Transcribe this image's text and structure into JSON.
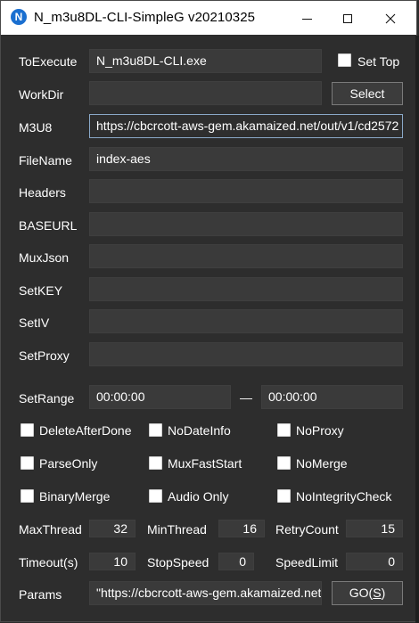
{
  "window": {
    "title": "N_m3u8DL-CLI-SimpleG v20210325",
    "icon_letter": "N"
  },
  "form": {
    "toexecute": {
      "label": "ToExecute",
      "value": "N_m3u8DL-CLI.exe"
    },
    "set_top": {
      "label": "Set Top",
      "checked": false
    },
    "workdir": {
      "label": "WorkDir",
      "value": ""
    },
    "select_button": "Select",
    "m3u8": {
      "label": "M3U8",
      "value": "https://cbcrcott-aws-gem.akamaized.net/out/v1/cd2572"
    },
    "filename": {
      "label": "FileName",
      "value": "index-aes"
    },
    "headers": {
      "label": "Headers",
      "value": ""
    },
    "baseurl": {
      "label": "BASEURL",
      "value": ""
    },
    "muxjson": {
      "label": "MuxJson",
      "value": ""
    },
    "setkey": {
      "label": "SetKEY",
      "value": ""
    },
    "setiv": {
      "label": "SetIV",
      "value": ""
    },
    "setproxy": {
      "label": "SetProxy",
      "value": ""
    },
    "setrange": {
      "label": "SetRange",
      "start": "00:00:00",
      "separator": "—",
      "end": "00:00:00"
    }
  },
  "options": [
    {
      "label": "DeleteAfterDone",
      "checked": false
    },
    {
      "label": "NoDateInfo",
      "checked": false
    },
    {
      "label": "NoProxy",
      "checked": false
    },
    {
      "label": "ParseOnly",
      "checked": false
    },
    {
      "label": "MuxFastStart",
      "checked": false
    },
    {
      "label": "NoMerge",
      "checked": false
    },
    {
      "label": "BinaryMerge",
      "checked": false
    },
    {
      "label": "Audio Only",
      "checked": false
    },
    {
      "label": "NoIntegrityCheck",
      "checked": false
    }
  ],
  "numbers": {
    "maxthread": {
      "label": "MaxThread",
      "value": "32"
    },
    "minthread": {
      "label": "MinThread",
      "value": "16"
    },
    "retrycount": {
      "label": "RetryCount",
      "value": "15"
    },
    "timeout": {
      "label": "Timeout(s)",
      "value": "10"
    },
    "stopspeed": {
      "label": "StopSpeed",
      "value": "0"
    },
    "speedlimit": {
      "label": "SpeedLimit",
      "value": "0"
    }
  },
  "params": {
    "label": "Params",
    "value": "\"https://cbcrcott-aws-gem.akamaized.net"
  },
  "go_button": {
    "prefix": "GO(",
    "key": "S",
    "suffix": ")"
  }
}
